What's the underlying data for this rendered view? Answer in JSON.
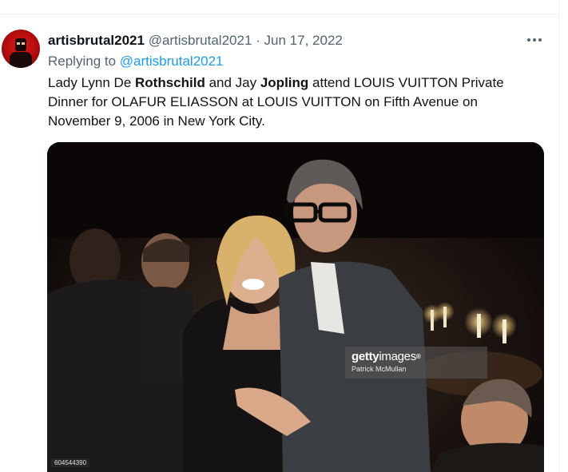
{
  "tweet": {
    "display_name": "artisbrutal2021",
    "handle": "@artisbrutal2021",
    "separator": "·",
    "date": "Jun 17, 2022",
    "replying_prefix": "Replying to",
    "replying_to": "@artisbrutal2021",
    "text_parts": [
      "Lady Lynn De ",
      "Rothschild",
      " and Jay ",
      "Jopling",
      " attend LOUIS VUITTON Private Dinner for OLAFUR ELIASSON at LOUIS VUITTON on Fifth Avenue on November 9, 2006 in New York City."
    ],
    "more_icon": "more-horizontal-icon"
  },
  "media": {
    "watermark_brand_bold": "getty",
    "watermark_brand_thin": "images",
    "watermark_mark": "®",
    "credit": "Patrick McMullan",
    "image_id": "604544390"
  },
  "colors": {
    "link": "#1d9bf0",
    "secondary_text": "#536471",
    "primary_text": "#0f1419",
    "divider": "#eff3f4"
  }
}
